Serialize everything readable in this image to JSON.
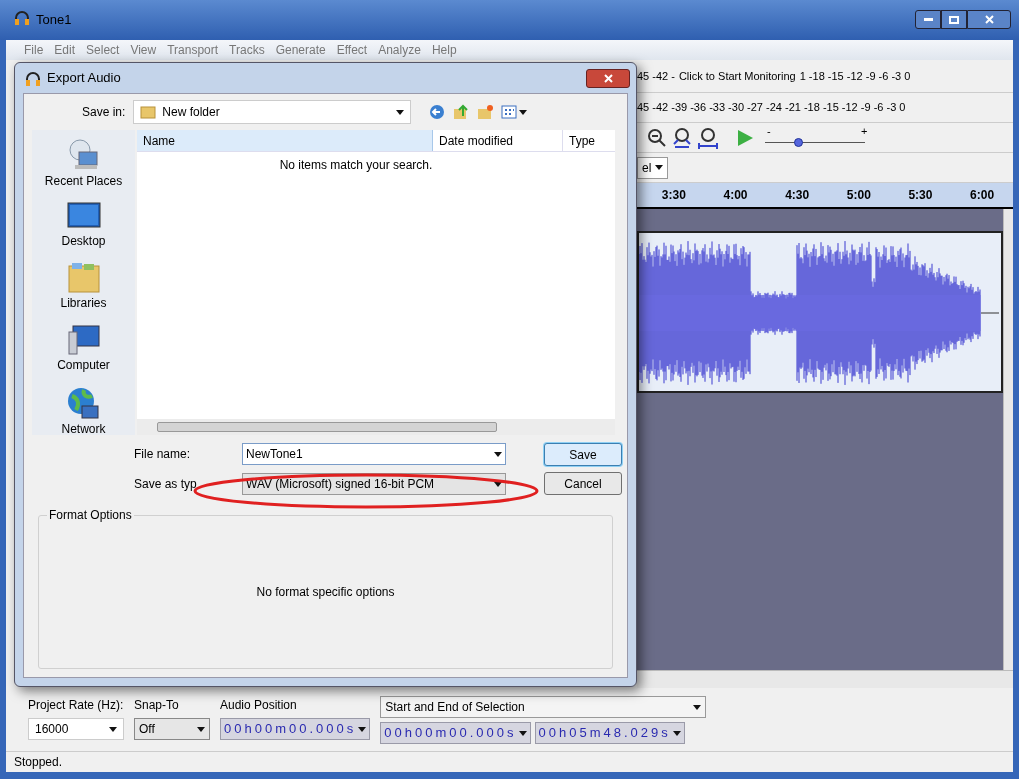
{
  "window": {
    "title": "Tone1"
  },
  "menu": [
    "File",
    "Edit",
    "Select",
    "View",
    "Transport",
    "Tracks",
    "Generate",
    "Effect",
    "Analyze",
    "Help"
  ],
  "meters": {
    "record": {
      "scale_left": "45 -42 -",
      "message": "Click to Start Monitoring",
      "scale_right": "1 -18 -15 -12 -9 -6 -3 0"
    },
    "playback": {
      "scale": "45 -42 -39 -36 -33 -30 -27 -24 -21 -18 -15 -12 -9 -6 -3 0"
    }
  },
  "play_speed": {
    "minus": "-",
    "plus": "+",
    "level": 0.33
  },
  "partial_dropdown": {
    "value": "el"
  },
  "timeline": [
    "3:30",
    "4:00",
    "4:30",
    "5:00",
    "5:30",
    "6:00"
  ],
  "dialog": {
    "title": "Export Audio",
    "save_in_label": "Save in:",
    "save_in": "New folder",
    "places": [
      {
        "kind": "recent",
        "label": "Recent Places"
      },
      {
        "kind": "desktop",
        "label": "Desktop"
      },
      {
        "kind": "libraries",
        "label": "Libraries"
      },
      {
        "kind": "computer",
        "label": "Computer"
      },
      {
        "kind": "network",
        "label": "Network"
      }
    ],
    "columns": [
      "Name",
      "Date modified",
      "Type"
    ],
    "empty_message": "No items match your search.",
    "file_name_label": "File name:",
    "file_name": "NewTone1",
    "save_as_label": "Save as typ",
    "save_as": "WAV (Microsoft) signed 16-bit PCM",
    "buttons": [
      {
        "label": "Save",
        "default": true
      },
      {
        "label": "Cancel",
        "default": false
      }
    ],
    "format_options": {
      "title": "Format Options",
      "message": "No format specific options"
    }
  },
  "bottom_toolbar": {
    "project_rate_label": "Project Rate (Hz):",
    "project_rate": "16000",
    "snap_label": "Snap-To",
    "snap": "Off",
    "position_label": "Audio Position",
    "position": "00h00m00.000s",
    "selection_mode": "Start and End of Selection",
    "selection_start": "00h00m00.000s",
    "selection_end": "00h05m48.029s"
  },
  "status_bar": "Stopped."
}
